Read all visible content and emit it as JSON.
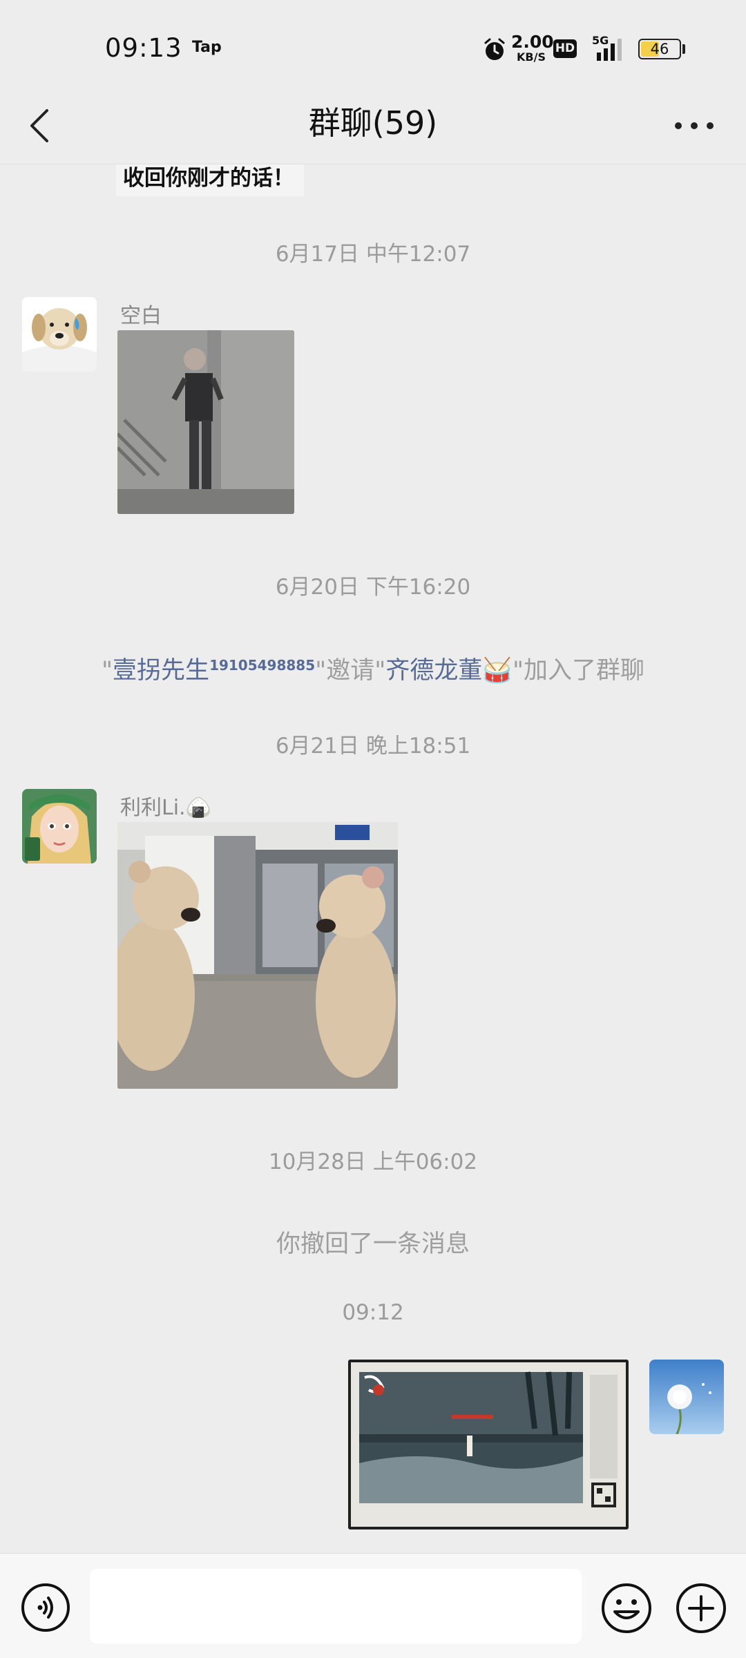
{
  "status_bar": {
    "time": "09:13",
    "carrier_tag": "Tap",
    "net_speed_value": "2.00",
    "net_speed_unit": "KB/S",
    "hd_badge": "HD",
    "network": "5G",
    "battery_level": "46"
  },
  "header": {
    "title": "群聊(59)"
  },
  "messages": {
    "recalled_snippet_text": "收回你刚才的话！",
    "ts1": "6月17日 中午12:07",
    "msg1_sender": "空白",
    "ts2": "6月20日 下午16:20",
    "sys_quote_open": "\"",
    "sys_inviter": "壹拐先生",
    "sys_inviter_phone": "19105498885",
    "sys_invite_mid": "\"邀请\"",
    "sys_invitee": "齐德龙董",
    "sys_invitee_emoji": "🥁",
    "sys_invite_end": "\"加入了群聊",
    "ts3": "6月21日 晚上18:51",
    "msg2_sender": "利利Li.",
    "msg2_sender_emoji": "🍙",
    "ts4": "10月28日 上午06:02",
    "recall_notice": "你撤回了一条消息",
    "ts5": "09:12"
  },
  "input_bar": {
    "placeholder": ""
  },
  "colors": {
    "background": "#ededed",
    "link_blue": "#576b95",
    "system_gray": "#9e9e9e",
    "battery_fill": "#f4cf4a"
  },
  "icons": [
    "back-icon",
    "more-icon",
    "voice-icon",
    "emoji-icon",
    "plus-icon",
    "alarm-icon",
    "signal-icon",
    "battery-icon"
  ]
}
